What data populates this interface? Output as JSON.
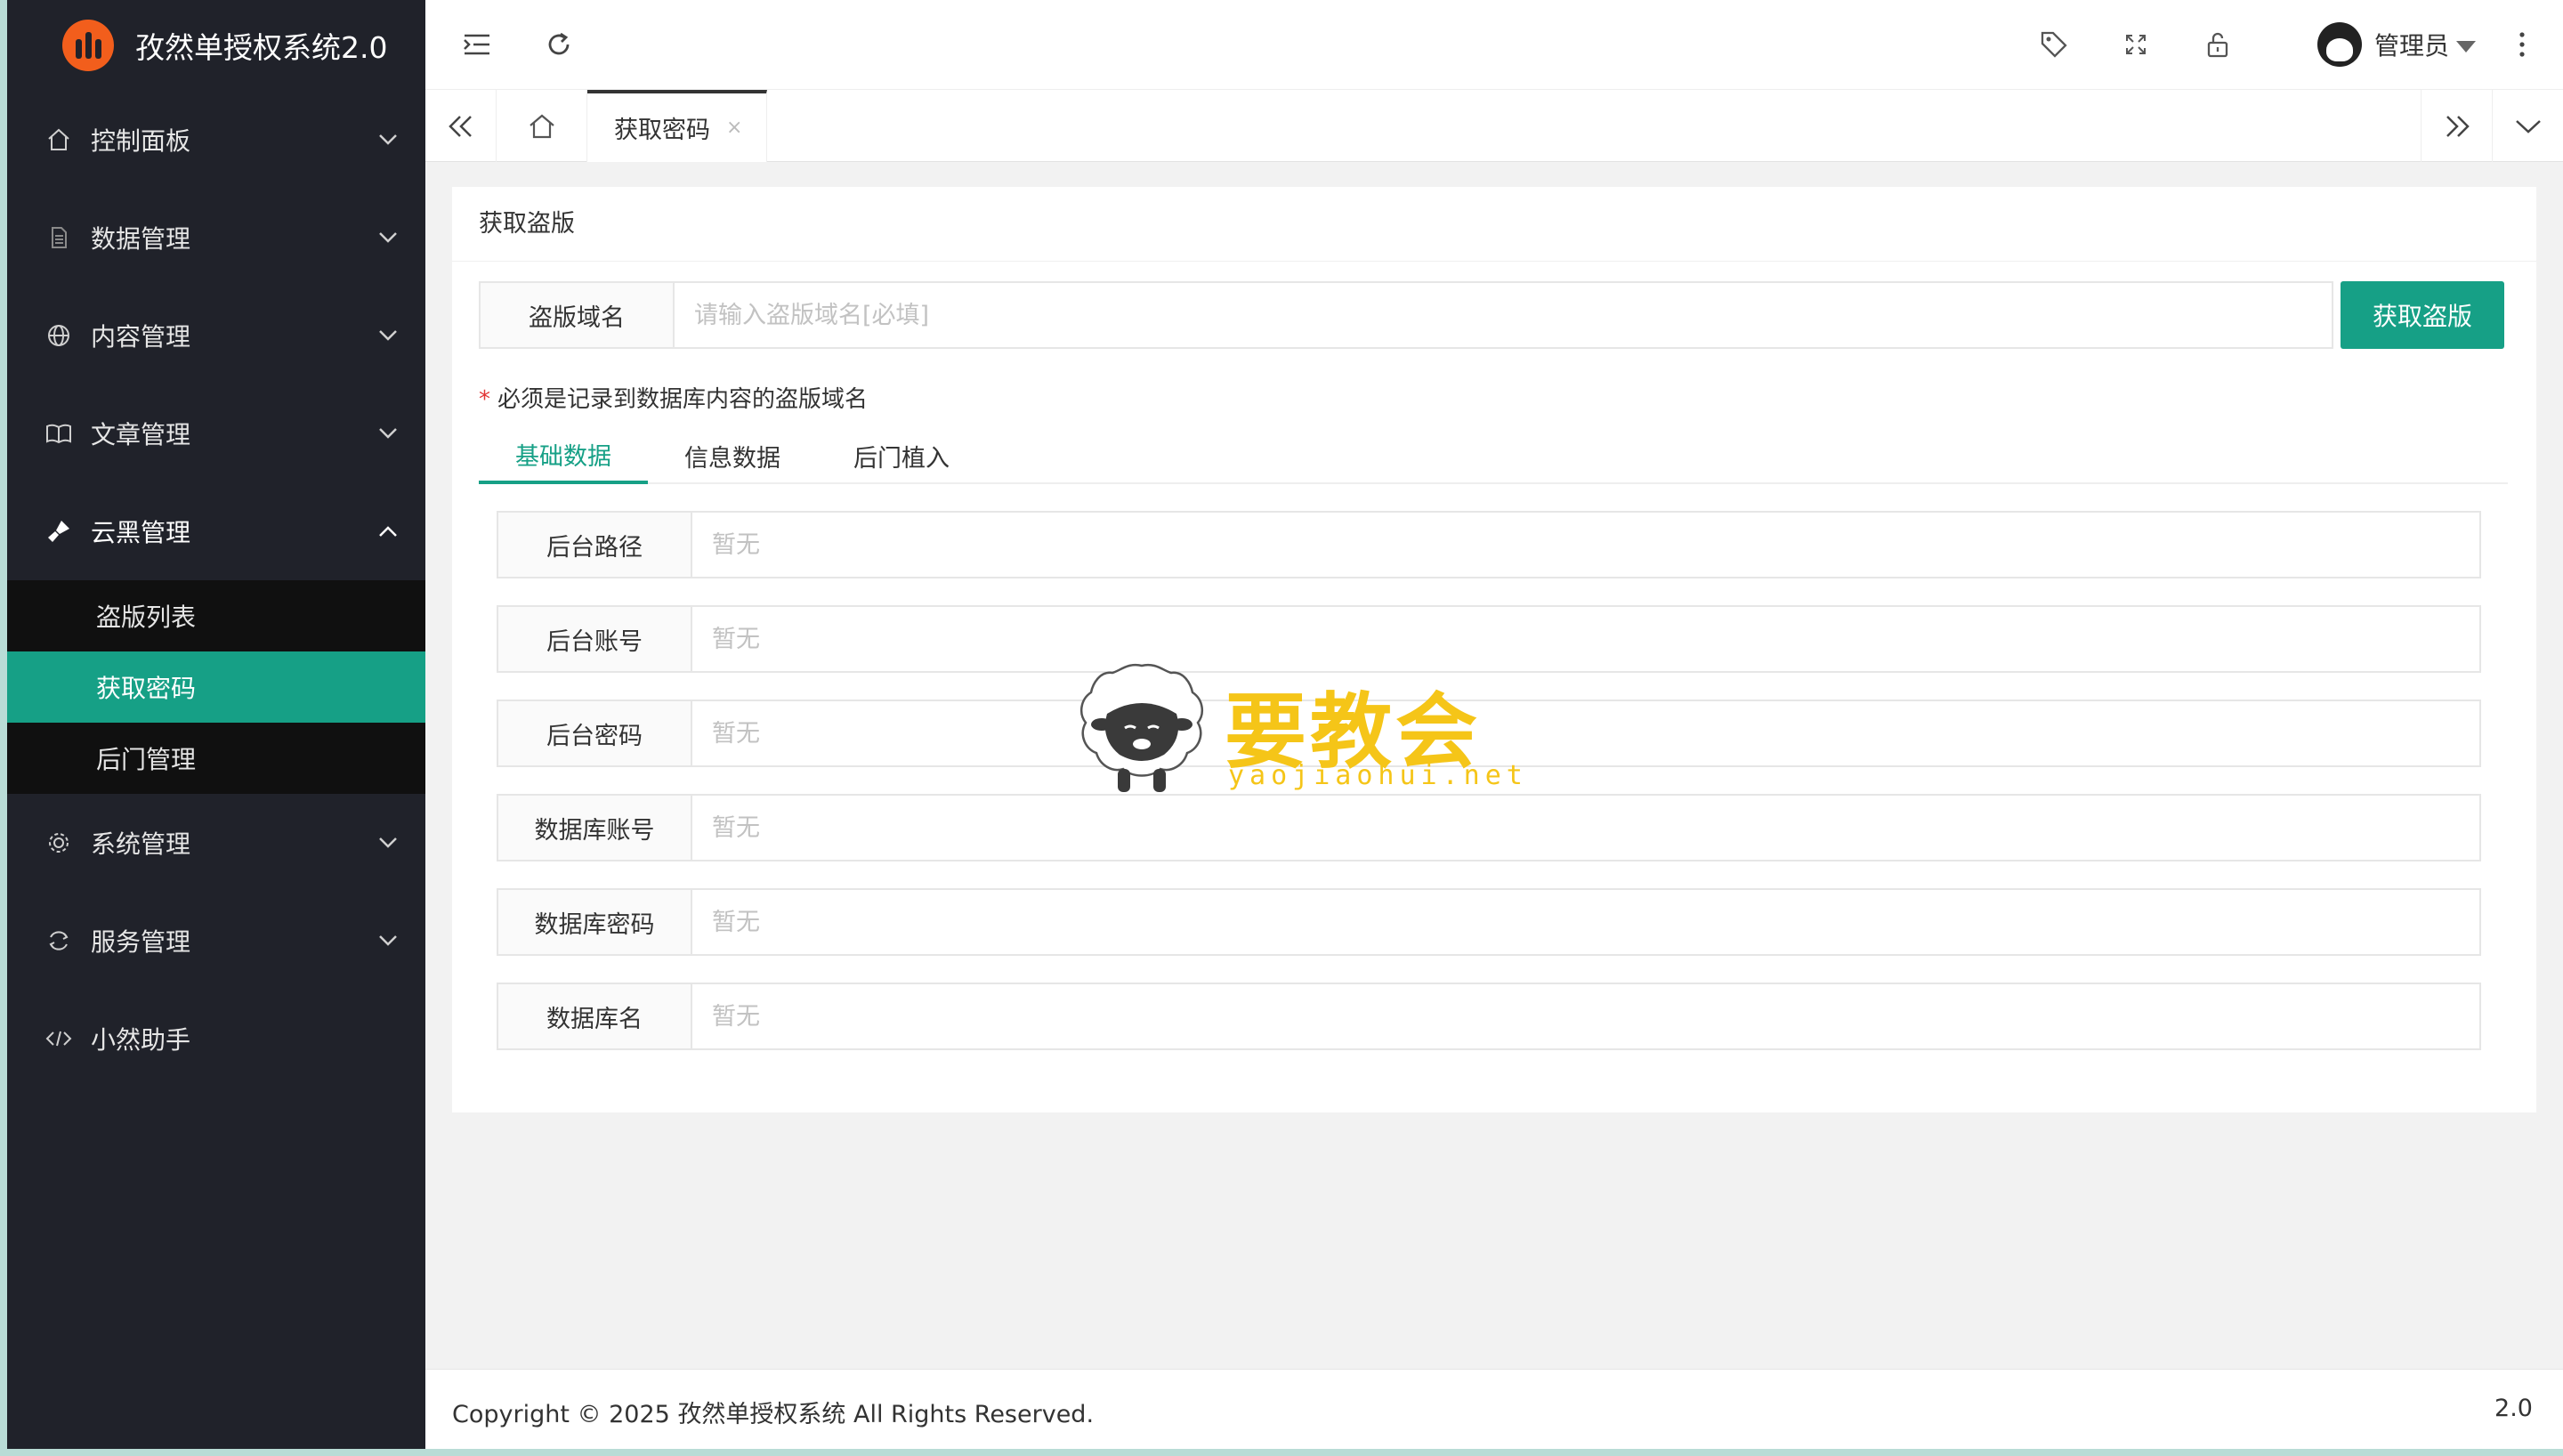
{
  "app": {
    "title": "孜然单授权系统2.0"
  },
  "sidebar": {
    "menu": [
      {
        "label": "控制面板",
        "icon": "home-icon"
      },
      {
        "label": "数据管理",
        "icon": "document-icon"
      },
      {
        "label": "内容管理",
        "icon": "globe-icon"
      },
      {
        "label": "文章管理",
        "icon": "book-icon"
      },
      {
        "label": "云黑管理",
        "icon": "brush-icon",
        "open": true
      },
      {
        "label": "系统管理",
        "icon": "gear-icon"
      },
      {
        "label": "服务管理",
        "icon": "service-icon"
      },
      {
        "label": "小然助手",
        "icon": "code-icon"
      }
    ],
    "submenu": [
      {
        "label": "盗版列表"
      },
      {
        "label": "获取密码",
        "active": true
      },
      {
        "label": "后门管理"
      }
    ]
  },
  "header": {
    "user": "管理员"
  },
  "tabbar": {
    "active_tab": "获取密码",
    "close": "×"
  },
  "card": {
    "title": "获取盗版",
    "domain_label": "盗版域名",
    "domain_placeholder": "请输入盗版域名[必填]",
    "domain_value": "",
    "button": "获取盗版",
    "hint_star": "*",
    "hint": "必须是记录到数据库内容的盗版域名",
    "tabs": [
      "基础数据",
      "信息数据",
      "后门植入"
    ],
    "fields": [
      {
        "label": "后台路径",
        "placeholder": "暂无"
      },
      {
        "label": "后台账号",
        "placeholder": "暂无"
      },
      {
        "label": "后台密码",
        "placeholder": "暂无"
      },
      {
        "label": "数据库账号",
        "placeholder": "暂无"
      },
      {
        "label": "数据库密码",
        "placeholder": "暂无"
      },
      {
        "label": "数据库名",
        "placeholder": "暂无"
      }
    ]
  },
  "footer": {
    "copyright": "Copyright © 2025 孜然单授权系统 All Rights Reserved.",
    "version": "2.0"
  },
  "watermark": {
    "text": "要教会",
    "url": "yaojiaohui.net"
  },
  "colors": {
    "accent": "#16a086",
    "sidebar": "#20222a",
    "logo": "#f25e1c",
    "watermark": "#f5c518"
  }
}
